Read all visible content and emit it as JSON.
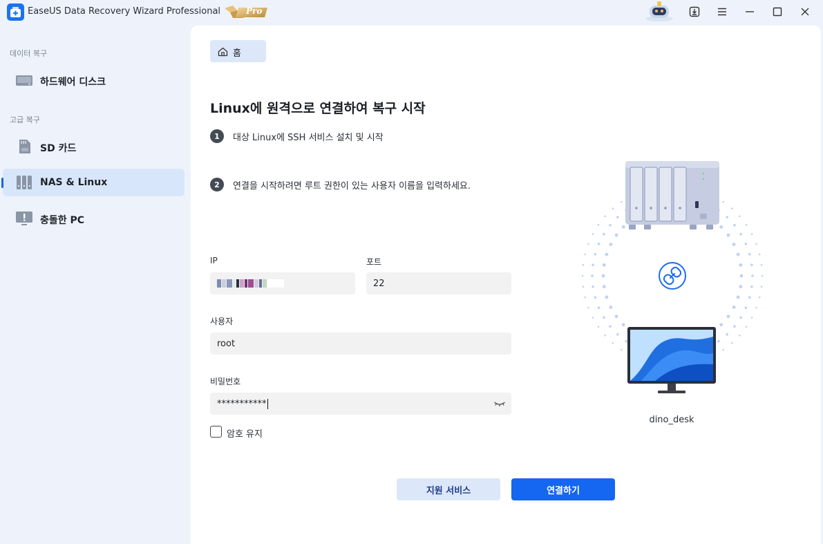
{
  "app": {
    "title": "EaseUS Data Recovery Wizard Professional",
    "badge": "Pro"
  },
  "titlebar": {
    "icons": [
      "robot-assistant-icon",
      "download-icon",
      "menu-icon",
      "minimize-icon",
      "maximize-icon",
      "close-icon"
    ]
  },
  "sidebar": {
    "sections": [
      {
        "title": "데이터 복구",
        "items": [
          {
            "label": "하드웨어 디스크",
            "icon": "hard-disk-icon",
            "active": false
          }
        ]
      },
      {
        "title": "고급 복구",
        "items": [
          {
            "label": "SD 카드",
            "icon": "sd-card-icon",
            "active": false
          },
          {
            "label": "NAS & Linux",
            "icon": "nas-icon",
            "active": true
          },
          {
            "label": "충돌한 PC",
            "icon": "crashed-pc-icon",
            "active": false
          }
        ]
      }
    ]
  },
  "breadcrumb": {
    "home_label": "홈"
  },
  "main": {
    "heading": "Linux에 원격으로 연결하여 복구 시작",
    "steps": [
      {
        "num": "1",
        "text": "대상 Linux에 SSH 서비스 설치 및 시작"
      },
      {
        "num": "2",
        "text": "연결을 시작하려면 루트 권한이 있는 사용자 이름을 입력하세요."
      }
    ],
    "form": {
      "ip_label": "IP",
      "port_label": "포트",
      "port_value": "22",
      "user_label": "사용자",
      "user_value": "root",
      "password_label": "비밀번호",
      "password_value": "***********",
      "remember_label": "암호 유지",
      "remember_checked": false
    },
    "buttons": {
      "support": "지원 서비스",
      "connect": "연결하기"
    },
    "device_name": "dino_desk"
  },
  "colors": {
    "accent": "#1566f0",
    "sidebar_bg": "#eef3fb",
    "active_item_bg": "#d8e6fb",
    "secondary_button_bg": "#dce8f9"
  }
}
